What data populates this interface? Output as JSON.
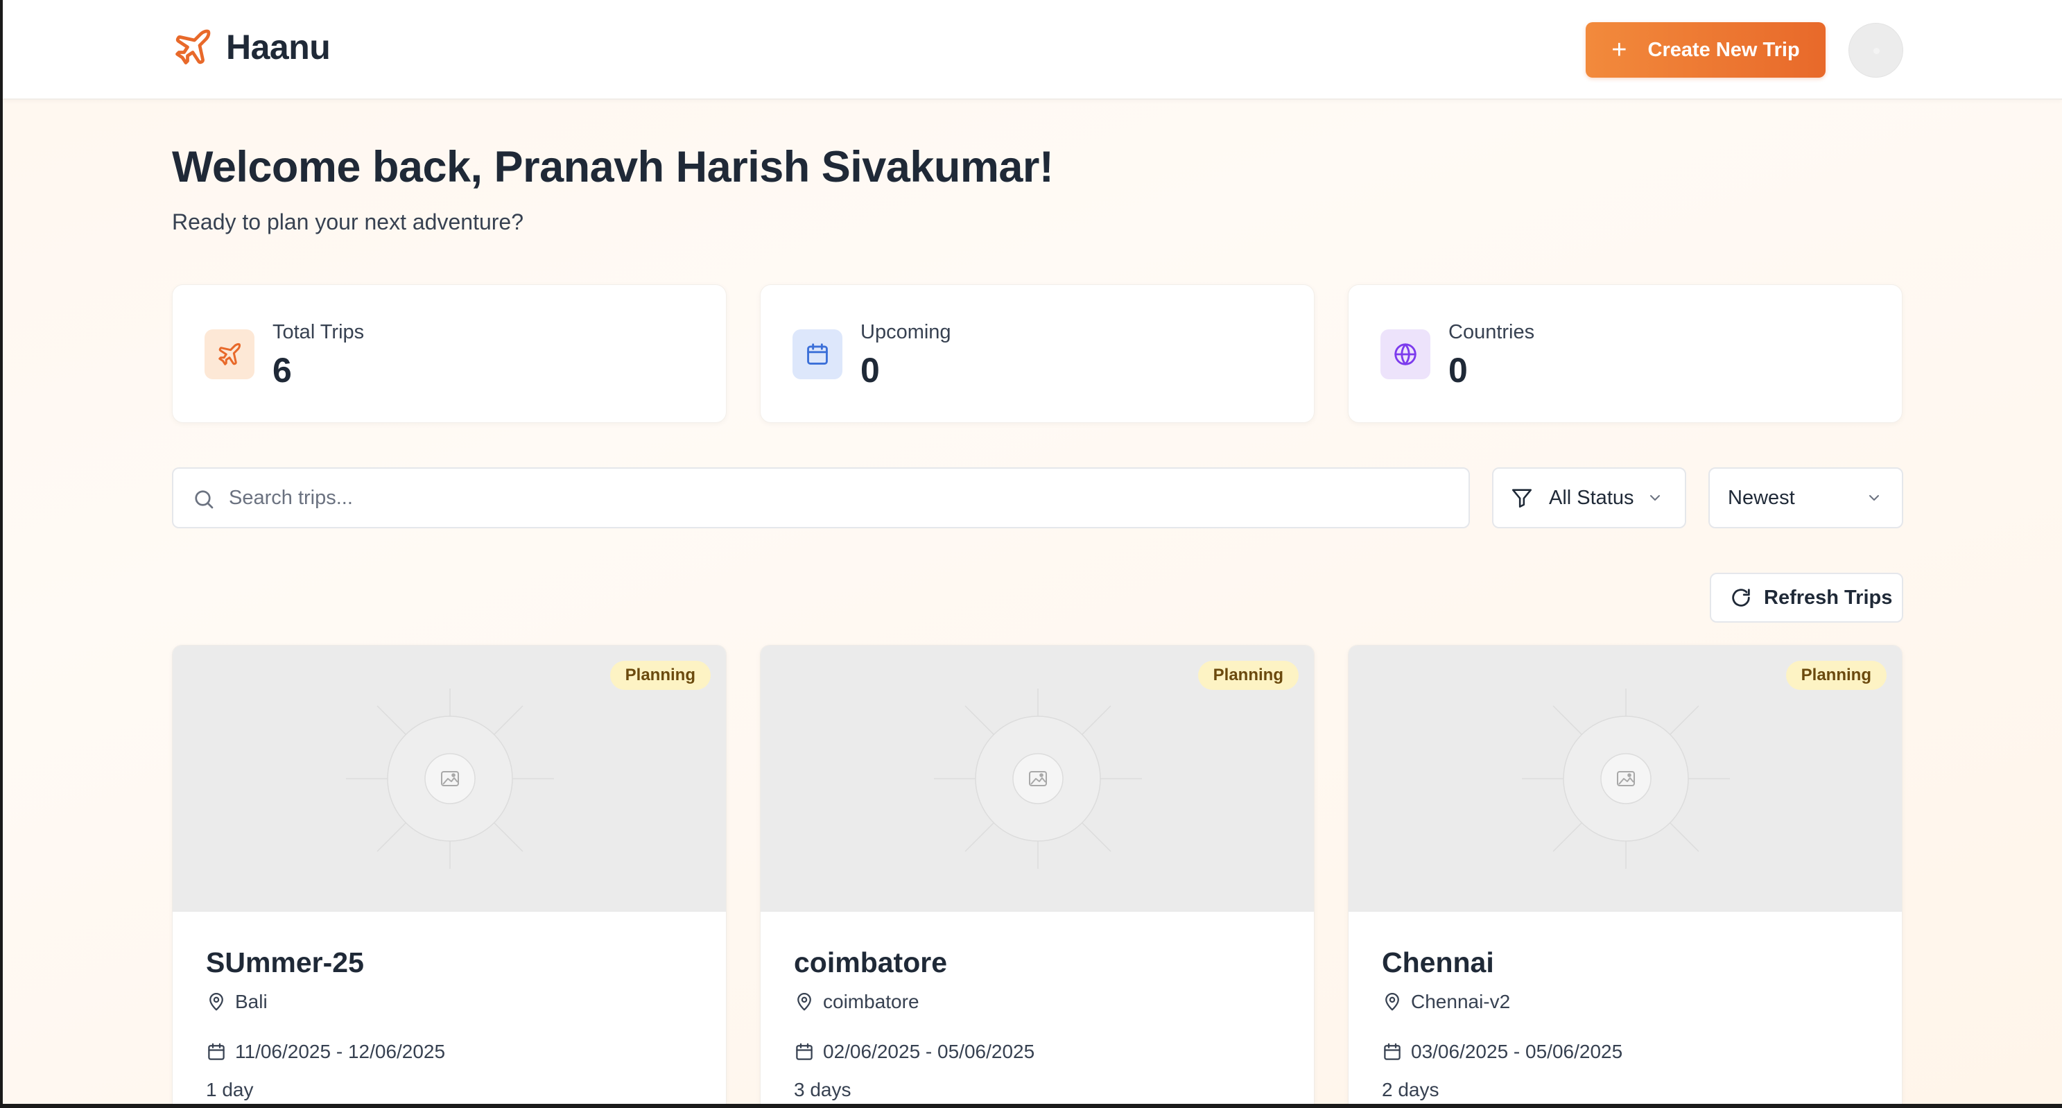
{
  "header": {
    "brand": "Haanu",
    "create_button": "Create New Trip",
    "brand_color": "#e8692a"
  },
  "welcome": {
    "title": "Welcome back, Pranavh Harish Sivakumar!",
    "subtitle": "Ready to plan your next adventure?"
  },
  "stats": [
    {
      "label": "Total Trips",
      "value": "6",
      "icon": "plane-icon"
    },
    {
      "label": "Upcoming",
      "value": "0",
      "icon": "calendar-icon"
    },
    {
      "label": "Countries",
      "value": "0",
      "icon": "globe-icon"
    }
  ],
  "filters": {
    "search_placeholder": "Search trips...",
    "search_value": "",
    "status_selected": "All Status",
    "sort_selected": "Newest"
  },
  "refresh_button": "Refresh Trips",
  "trips": [
    {
      "status": "Planning",
      "title": "SUmmer-25",
      "location": "Bali",
      "dates": "11/06/2025 - 12/06/2025",
      "duration": "1 day"
    },
    {
      "status": "Planning",
      "title": "coimbatore",
      "location": "coimbatore",
      "dates": "02/06/2025 - 05/06/2025",
      "duration": "3 days"
    },
    {
      "status": "Planning",
      "title": "Chennai",
      "location": "Chennai-v2",
      "dates": "03/06/2025 - 05/06/2025",
      "duration": "2 days"
    }
  ]
}
